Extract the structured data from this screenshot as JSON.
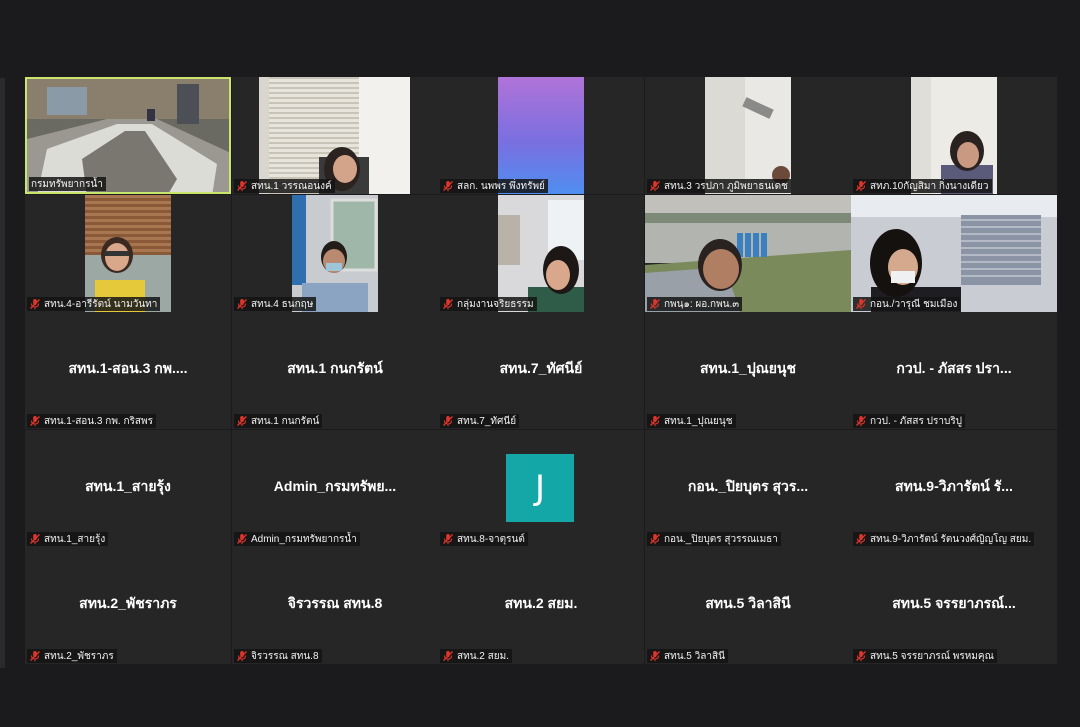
{
  "meeting": {
    "participants": [
      {
        "display": "",
        "label": "กรมทรัพยากรน้ำ",
        "mic_muted": false,
        "active": true,
        "video": "room"
      },
      {
        "display": "",
        "label": "สทน.1 วรรณอนงค์",
        "mic_muted": true,
        "video": "office-blinds"
      },
      {
        "display": "",
        "label": "สลก. นพพร พึ่งทรัพย์",
        "mic_muted": true,
        "video": "purple-gradient"
      },
      {
        "display": "",
        "label": "สทน.3 วรปภา ภูมิพยาธนเดช",
        "mic_muted": true,
        "video": "white-wall"
      },
      {
        "display": "",
        "label": "สทภ.10กัญสิมา กิ่งนางเดียว",
        "mic_muted": true,
        "video": "white-wall-woman"
      },
      {
        "display": "",
        "label": "สทน.4-อารีรัตน์ นามวันทา",
        "mic_muted": true,
        "video": "outdoor-yellow"
      },
      {
        "display": "",
        "label": "สทน.4 ธนกฤษ",
        "mic_muted": true,
        "video": "window-man"
      },
      {
        "display": "",
        "label": "กลุ่มงานจริยธรรม",
        "mic_muted": true,
        "video": "office-woman"
      },
      {
        "display": "",
        "label": "กพนฺ๑: ผอ.กพน.๓",
        "mic_muted": true,
        "video": "river-outdoor"
      },
      {
        "display": "",
        "label": "กอน./วารุณี ชมเมือง",
        "mic_muted": true,
        "video": "office-mask"
      },
      {
        "display": "สทน.1-สอน.3 กพ....",
        "label": "สทน.1-สอน.3 กพ. กริสพร",
        "mic_muted": true
      },
      {
        "display": "สทน.1 กนกรัตน์",
        "label": "สทน.1 กนกรัตน์",
        "mic_muted": true
      },
      {
        "display": "สทน.7_ทัศนีย์",
        "label": "สทน.7_ทัศนีย์",
        "mic_muted": true
      },
      {
        "display": "สทน.1_ปุณยนุช",
        "label": "สทน.1_ปุณยนุช",
        "mic_muted": true
      },
      {
        "display": "กวป. - ภัสสร ปรา...",
        "label": "กวป. - ภัสสร ปราบริปู",
        "mic_muted": true
      },
      {
        "display": "สทน.1_สายรุ้ง",
        "label": "สทน.1_สายรุ้ง",
        "mic_muted": true
      },
      {
        "display": "Admin_กรมทรัพย...",
        "label": "Admin_กรมทรัพยากรน้ำ",
        "mic_muted": true
      },
      {
        "display": "",
        "label": "สทน.8-จาตุรนต์",
        "mic_muted": true,
        "avatar": "J"
      },
      {
        "display": "กอน._ปิยบุตร สุวร...",
        "label": "กอน._ปิยบุตร สุวรรณเมธา",
        "mic_muted": true
      },
      {
        "display": "สทน.9-วิภารัตน์ รั...",
        "label": "สทน.9-วิภารัตน์ รัตนวงศ์ญิญโญ สยม.",
        "mic_muted": true
      },
      {
        "display": "สทน.2_พัชราภร",
        "label": "สทน.2_พัชราภร",
        "mic_muted": true
      },
      {
        "display": "จิรวรรณ สทน.8",
        "label": "จิรวรรณ สทน.8",
        "mic_muted": true
      },
      {
        "display": "สทน.2 สยม.",
        "label": "สทน.2 สยม.",
        "mic_muted": true
      },
      {
        "display": "สทน.5 วิลาสินี",
        "label": "สทน.5 วิลาสินี",
        "mic_muted": true
      },
      {
        "display": "สทน.5 จรรยาภรณ์...",
        "label": "สทน.5 จรรยาภรณ์ พรหมคุณ",
        "mic_muted": true
      }
    ],
    "colors": {
      "background": "#1b1b1d",
      "tile": "#262626",
      "active_border": "#c9e66a",
      "mic_muted_red": "#e0352b",
      "avatar_teal": "#13a7a7"
    },
    "icons": {
      "muted": "mic-muted-icon"
    }
  }
}
